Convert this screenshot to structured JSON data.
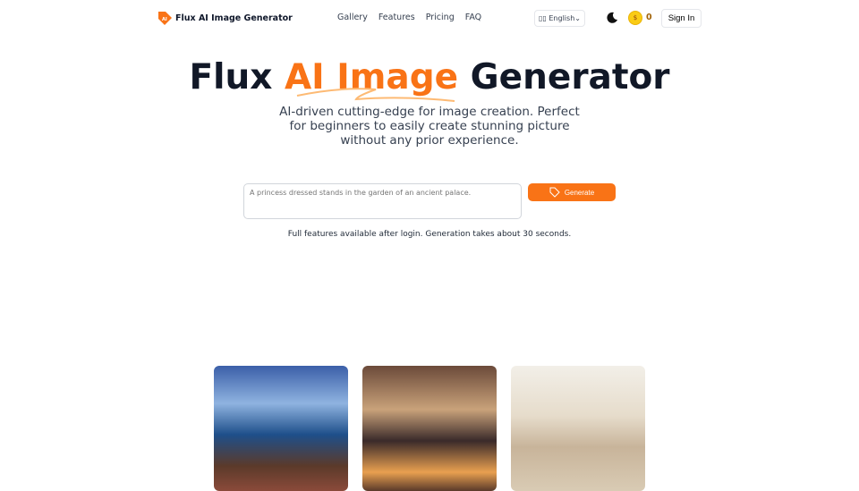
{
  "header": {
    "brand": "Flux AI Image Generator",
    "nav": [
      "Gallery",
      "Features",
      "Pricing",
      "FAQ"
    ],
    "language": "English",
    "credits": "0",
    "sign_in": "Sign In"
  },
  "hero": {
    "title_a": "Flux ",
    "title_b": "AI Image",
    "title_c": " Generator",
    "subtitle": "AI-driven cutting-edge for image creation. Perfect for beginners to easily create stunning picture without any prior experience."
  },
  "prompt": {
    "placeholder": "A princess dressed stands in the garden of an ancient palace.",
    "generate": "Generate",
    "note": "Full features available after login. Generation takes about 30 seconds."
  },
  "colors": {
    "accent": "#f97316"
  },
  "gallery": [
    "pirate-girl",
    "mage-girl",
    "desert-traveler"
  ]
}
